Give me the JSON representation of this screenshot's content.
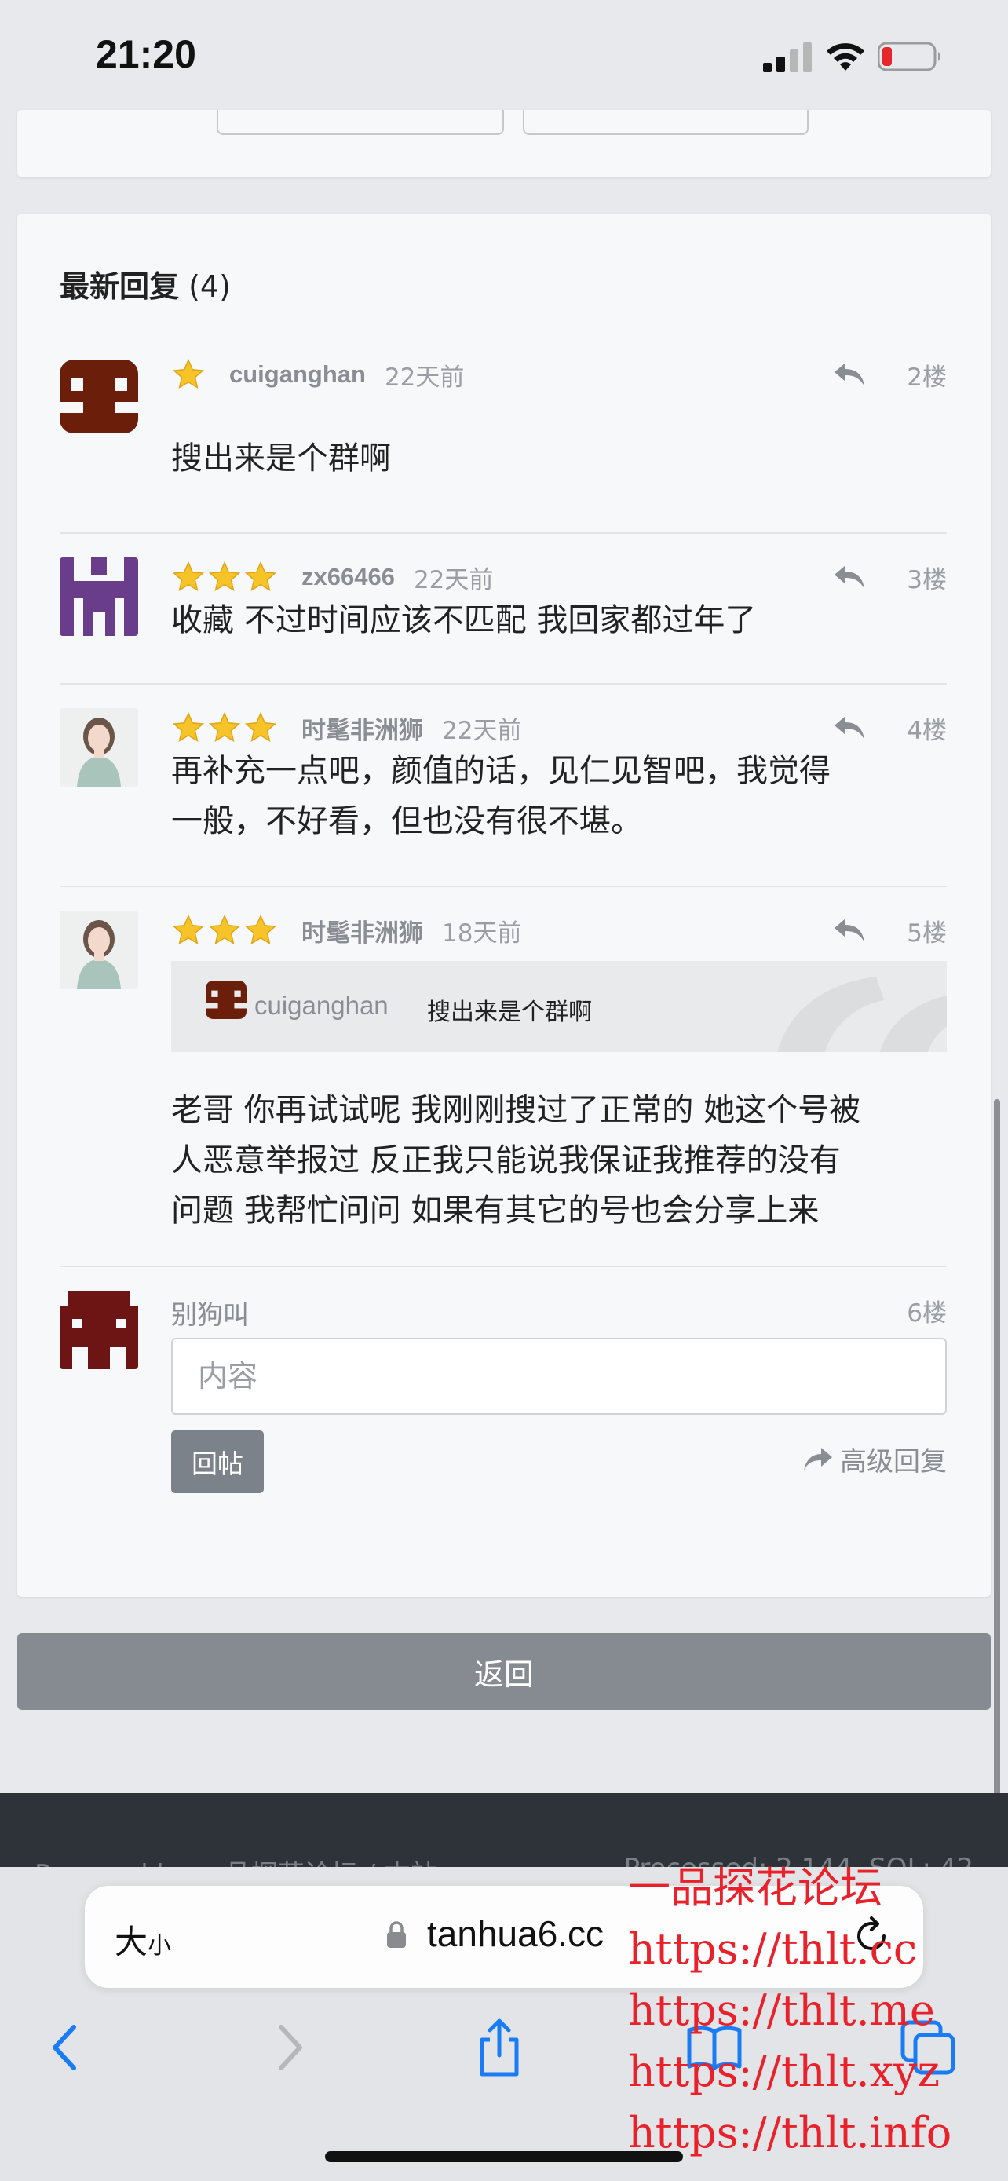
{
  "status_bar": {
    "time": "21:20"
  },
  "thread": {
    "section_title": "最新回复",
    "reply_count": "(4)",
    "posts": [
      {
        "user": "cuiganghan",
        "time": "22天前",
        "floor": "2楼",
        "stars": 1,
        "content": "搜出来是个群啊"
      },
      {
        "user": "zx66466",
        "time": "22天前",
        "floor": "3楼",
        "stars": 3,
        "content": "收藏 不过时间应该不匹配  我回家都过年了"
      },
      {
        "user": "时髦非洲狮",
        "time": "22天前",
        "floor": "4楼",
        "stars": 3,
        "content_lines": [
          "再补充一点吧，颜值的话，见仁见智吧，我觉得",
          "一般，不好看，但也没有很不堪。"
        ]
      },
      {
        "user": "时髦非洲狮",
        "time": "18天前",
        "floor": "5楼",
        "stars": 3,
        "quote": {
          "user": "cuiganghan",
          "text": "搜出来是个群啊"
        },
        "content_lines": [
          "老哥 你再试试呢 我刚刚搜过了正常的 她这个号被",
          "人恶意举报过 反正我只能说我保证我推荐的没有",
          "问题 我帮忙问问 如果有其它的号也会分享上来"
        ]
      }
    ],
    "reply_form": {
      "user": "别狗叫",
      "floor": "6楼",
      "placeholder": "内容",
      "submit_label": "回帖",
      "advanced_label": "高级回复"
    },
    "back_label": "返回"
  },
  "footer": {
    "left_text": "Powered by 一品探花论坛 / 本站",
    "right_text": "Processed: 2.144, SQL: 42"
  },
  "safari": {
    "text_size_label": "大",
    "text_size_small": "小",
    "url": "tanhua6.cc"
  },
  "watermark": {
    "lines": [
      "一品探花论坛",
      "https://thlt.cc",
      "https://thlt.me",
      "https://thlt.xyz",
      "https://thlt.info"
    ]
  },
  "colors": {
    "avatar_brown": "#6b1f0a",
    "avatar_purple": "#6a3d8a",
    "avatar_darkred": "#6d1514",
    "star_gold": "#f6c428",
    "watermark_red": "#e8212b"
  }
}
